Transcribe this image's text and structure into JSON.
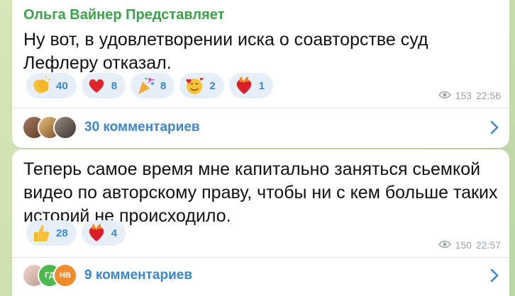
{
  "colors": {
    "sender": "#3aa34a",
    "accent": "#3a86cf",
    "reaction_bg": "#e6eff8",
    "meta": "#9aa3a9"
  },
  "messages": [
    {
      "sender": "Ольга Вайнер Представляет",
      "text": "Ну вот, в удовлетворении иска о соавторстве суд Лефлеру отказал.",
      "reactions": [
        {
          "icon": "clapping-hands-icon",
          "count": "40"
        },
        {
          "icon": "red-heart-icon",
          "count": "8"
        },
        {
          "icon": "party-popper-icon",
          "count": "8"
        },
        {
          "icon": "smiling-face-with-hearts-icon",
          "count": "2"
        },
        {
          "icon": "heart-on-fire-icon",
          "count": "1"
        }
      ],
      "views": "153",
      "time": "22:56",
      "comments_label": "30 комментариев"
    },
    {
      "text": "Теперь самое время мне капитально заняться сьемкой видео по авторскому праву, чтобы ни с кем больше таких историй не происходило.",
      "reactions": [
        {
          "icon": "thumbs-up-icon",
          "count": "28"
        },
        {
          "icon": "heart-on-fire-icon",
          "count": "4"
        }
      ],
      "views": "150",
      "time": "22:57",
      "comments_label": "9 комментариев",
      "avatar_initials": [
        "ГД",
        "НВ"
      ]
    }
  ]
}
